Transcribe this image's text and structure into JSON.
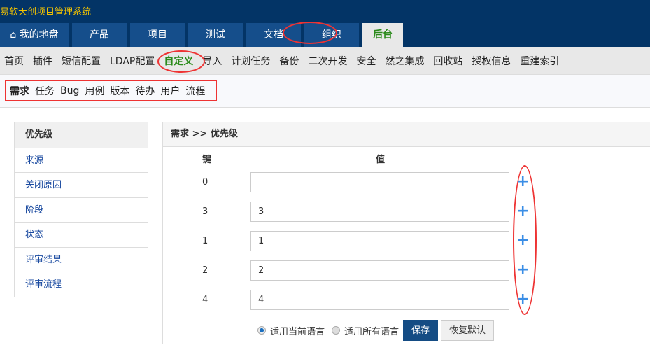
{
  "brand": "易软天创项目管理系统",
  "main_nav": [
    "我的地盘",
    "产品",
    "项目",
    "测试",
    "文档",
    "组织",
    "后台"
  ],
  "sub_nav": [
    "首页",
    "插件",
    "短信配置",
    "LDAP配置",
    "自定义",
    "导入",
    "计划任务",
    "备份",
    "二次开发",
    "安全",
    "然之集成",
    "回收站",
    "授权信息",
    "重建索引"
  ],
  "module_nav": [
    "需求",
    "任务",
    "Bug",
    "用例",
    "版本",
    "待办",
    "用户",
    "流程"
  ],
  "sidebar": [
    "优先级",
    "来源",
    "关闭原因",
    "阶段",
    "状态",
    "评审结果",
    "评审流程"
  ],
  "panel": {
    "title": "需求 >> 优先级",
    "key_header": "键",
    "value_header": "值",
    "rows": [
      {
        "key": "0",
        "value": ""
      },
      {
        "key": "3",
        "value": "3"
      },
      {
        "key": "1",
        "value": "1"
      },
      {
        "key": "2",
        "value": "2"
      },
      {
        "key": "4",
        "value": "4"
      }
    ],
    "radio_current": "适用当前语言",
    "radio_all": "适用所有语言",
    "save": "保存",
    "restore": "恢复默认"
  }
}
